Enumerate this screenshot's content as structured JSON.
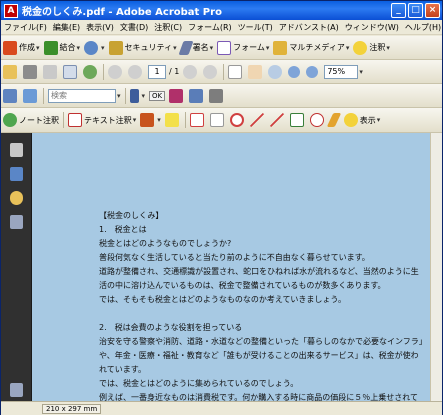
{
  "window": {
    "title": "税金のしくみ.pdf - Adobe Acrobat Pro",
    "app_icon_label": "A"
  },
  "menu": [
    "ファイル(F)",
    "編集(E)",
    "表示(V)",
    "文書(D)",
    "注釈(C)",
    "フォーム(R)",
    "ツール(T)",
    "アドバンスト(A)",
    "ウィンドウ(W)",
    "ヘルプ(H)"
  ],
  "toolbar1": {
    "create": "作成",
    "combine": "結合",
    "security": "セキュリティ",
    "sign": "署名",
    "forms": "フォーム",
    "multimedia": "マルチメディア",
    "comments": "注釈"
  },
  "toolbar2": {
    "page_current": "1",
    "page_total": "/ 1",
    "zoom": "75%"
  },
  "toolbar3": {
    "search_placeholder": "検索",
    "ok": "OK"
  },
  "toolbar4": {
    "note": "ノート注釈",
    "text_note": "テキスト注釈",
    "show": "表示"
  },
  "document": {
    "lines": [
      "【税金のしくみ】",
      "1.　税金とは",
      "税金とはどのようなものでしょうか?",
      "普段何気なく生活していると当たり前のように不自由なく暮らせています。",
      "道路が整備され、交通標識が設置され、蛇口をひねれば水が流れるなど、当然のように生",
      "活の中に溶け込んでいるものは、税金で整備されているものが数多くあります。",
      "では、そもそも税金とはどのようなものなのか考えていきましょう。",
      "",
      "2.　税は会費のような役割を担っている",
      "治安を守る警察や消防、道路・水道などの整備といった「暮らしのなかで必要なインフラ」",
      "や、年金・医療・福祉・教育など「誰もが受けることの出来るサービス」は、税金が使わ",
      "れています。",
      "では、税金とはどのように集められているのでしょう。",
      "例えば、一番身近なものは消費税です。何か購入する時に商品の価段に５％上乗せされて"
    ]
  },
  "status": {
    "page_size": "210 x 297 mm"
  }
}
